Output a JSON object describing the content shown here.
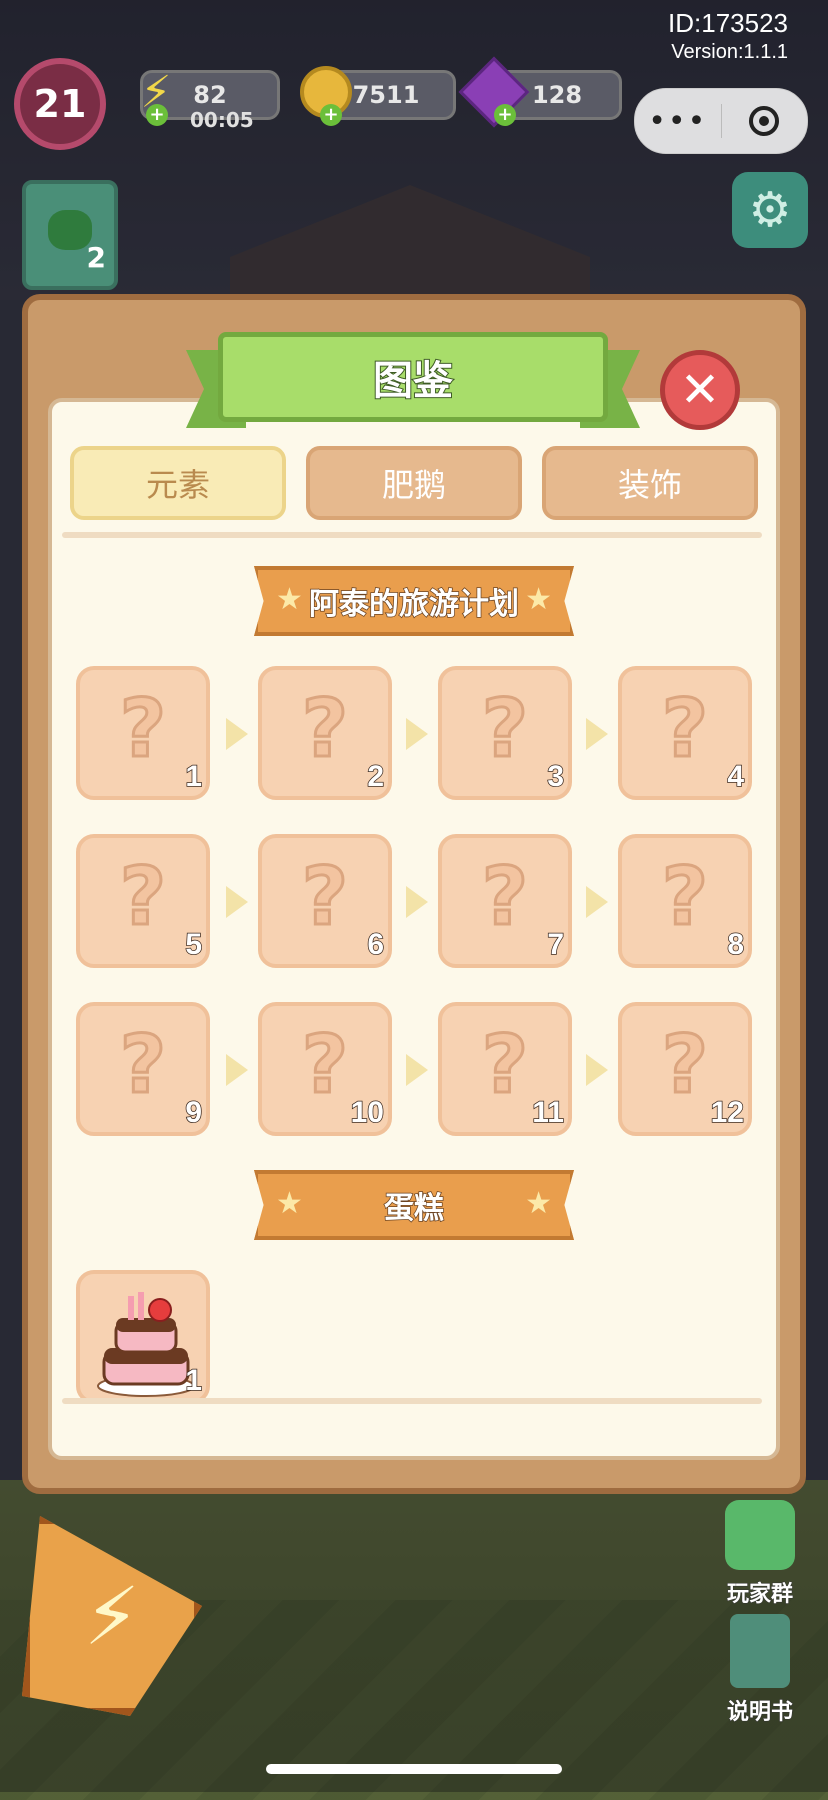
{
  "header": {
    "id_text": "ID:173523",
    "version_text": "Version:1.1.1",
    "level": "21",
    "energy": {
      "value": "82",
      "timer": "00:05",
      "icon": "lightning-icon"
    },
    "coins": {
      "value": "7511",
      "icon": "coin-icon"
    },
    "gems": {
      "value": "128",
      "icon": "gem-icon"
    },
    "capsule": {
      "more_icon": "more-dots-icon",
      "close_icon": "target-circle-icon"
    },
    "settings_icon": "gear-icon",
    "task_card_count": "2"
  },
  "dialog": {
    "title": "图鉴",
    "close_icon": "close-icon",
    "tabs": [
      {
        "label": "元素",
        "active": true
      },
      {
        "label": "肥鹅",
        "active": false
      },
      {
        "label": "装饰",
        "active": false
      }
    ],
    "sections": [
      {
        "title": "阿泰的旅游计划",
        "items": [
          "1",
          "2",
          "3",
          "4",
          "5",
          "6",
          "7",
          "8",
          "9",
          "10",
          "11",
          "12"
        ],
        "locked_icon": "question-mark-icon"
      },
      {
        "title": "蛋糕",
        "items": [
          "1"
        ],
        "item_icon": "cake-icon"
      }
    ]
  },
  "side": {
    "player_group": "玩家群",
    "manual": "说明书"
  },
  "colors": {
    "panel": "#c99a6a",
    "paper": "#fdf9ea",
    "ribbon": "#a8dd6a",
    "banner": "#e99e4d",
    "tile": "#f7d2b2",
    "close": "#e65b5b"
  }
}
